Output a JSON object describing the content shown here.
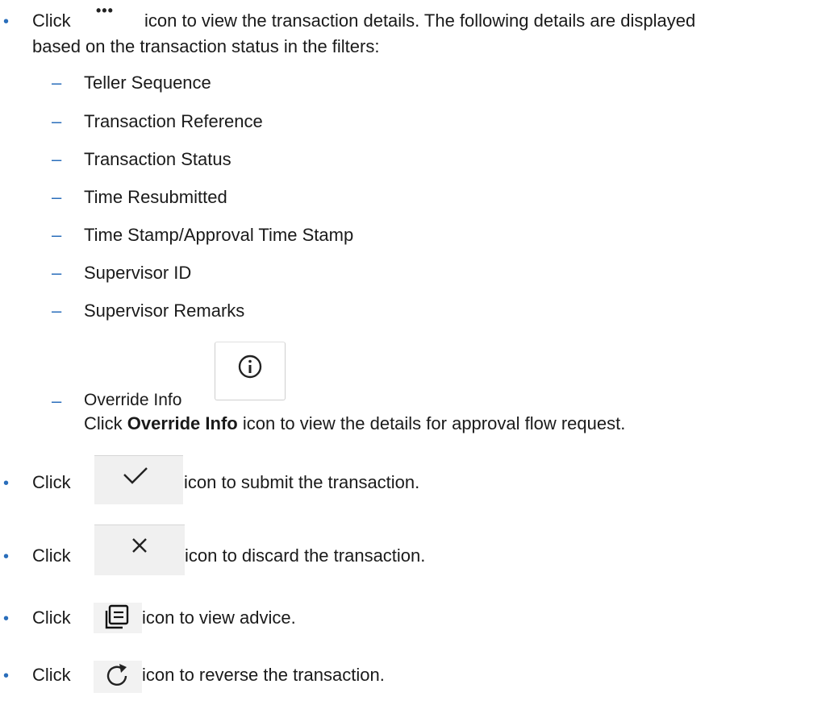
{
  "intro": {
    "click": "Click",
    "dots_icon": "•••",
    "line1_rest": "icon to view the transaction details. The following details are displayed",
    "line2": "based on the transaction status in the filters:"
  },
  "details": [
    "Teller Sequence",
    "Transaction Reference",
    "Transaction Status",
    "Time Resubmitted",
    "Time Stamp/Approval Time Stamp",
    "Supervisor ID",
    "Supervisor Remarks",
    "Override Info"
  ],
  "override": {
    "click": "Click",
    "bold": "Override Info",
    "rest": "icon to view the details for approval flow request."
  },
  "actions": [
    {
      "click": "Click",
      "icon": "check-icon",
      "text": "icon to submit the transaction."
    },
    {
      "click": "Click",
      "icon": "close-icon",
      "text": "icon to discard the transaction."
    },
    {
      "click": "Click",
      "icon": "advice-icon",
      "text": "icon to view advice."
    },
    {
      "click": "Click",
      "icon": "reverse-icon",
      "text": "icon to reverse the transaction."
    }
  ],
  "glyphs": {
    "bullet": "•",
    "dash": "–"
  },
  "colors": {
    "accent": "#2a6ebb",
    "text": "#1a1a1a"
  }
}
